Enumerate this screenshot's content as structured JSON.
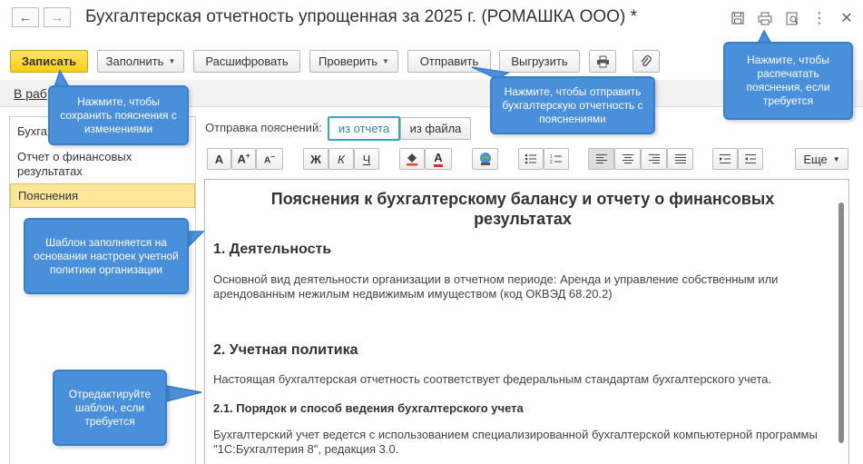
{
  "window": {
    "title": "Бухгалтерская отчетность упрощенная за 2025 г. (РОМАШКА ООО) *",
    "back_icon": "arrow-left-icon",
    "forward_icon": "arrow-right-icon",
    "title_icons": [
      "save-icon",
      "print-icon",
      "preview-icon",
      "more-icon",
      "close-icon"
    ]
  },
  "toolbar": {
    "save": "Записать",
    "fill": "Заполнить",
    "decode": "Расшифровать",
    "check": "Проверить",
    "send": "Отправить",
    "export": "Выгрузить",
    "print_icon": "printer-icon",
    "attach_icon": "paperclip-icon"
  },
  "tab_row": {
    "label": "В раб"
  },
  "left_list": {
    "items": [
      "Бухга",
      "Отчет о финансовых результатах",
      "Пояснения"
    ]
  },
  "send_row": {
    "label": "Отправка пояснений:",
    "from_report": "из отчета",
    "from_file": "из файла"
  },
  "format_toolbar": {
    "more": "Еще",
    "bold": "Ж",
    "italic": "К",
    "underline": "Ч"
  },
  "document": {
    "heading": "Пояснения к бухгалтерскому балансу и отчету о финансовых результатах",
    "s1_title": "1. Деятельность",
    "s1_text": "Основной вид деятельности организации в отчетном периоде: Аренда и управление собственным или арендованным нежилым недвижимым имуществом (код ОКВЭД 68.20.2)",
    "s2_title": "2. Учетная политика",
    "s2_text": "Настоящая бухгалтерская отчетность соответствует федеральным стандартам бухгалтерского учета.",
    "s21_title": "2.1. Порядок и способ ведения бухгалтерского учета",
    "s21_text": "Бухгалтерский учет ведется с использованием специализированной бухгалтерской компьютерной программы \"1С:Бухгалтерия 8\", редакция 3.0."
  },
  "callouts": {
    "save": "Нажмите, чтобы сохранить пояснения с изменениями",
    "send": "Нажмите, чтобы отправить бухгалтерскую отчетность с пояснениями",
    "print": "Нажмите, чтобы распечатать пояснения, если требуется",
    "template": "Шаблон заполняется на основании настроек учетной политики организации",
    "edit": "Отредактируйте шаблон, если требуется"
  },
  "colors": {
    "accent_callout": "#4a8fd9",
    "primary_button": "#f7ce1a",
    "selected_item": "#fbe69a",
    "active_toggle_border": "#3aa6b9"
  }
}
